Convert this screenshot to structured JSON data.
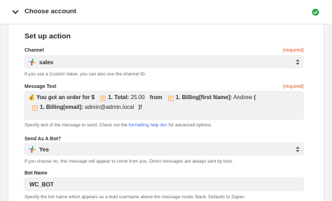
{
  "step": {
    "title": "Choose account"
  },
  "section": {
    "title": "Set up action"
  },
  "channel": {
    "label": "Channel",
    "required": "(required)",
    "value": "sales",
    "help": "If you use a Custom Value, you can also use the channel ID."
  },
  "message": {
    "label": "Message Text",
    "required": "(required)",
    "text_intro": "You got an order for $",
    "pill_total": "1. Total:",
    "total_value": "25.00",
    "from": "from",
    "pill_first_name": "1. Billing[first Name]:",
    "first_name_value": "Andrew",
    "paren_open": "(",
    "pill_email": "1. Billing[email]:",
    "email_value": "admin@admin.local",
    "close": ")!",
    "help_prefix": "Specify text of the message to send. Check out the",
    "help_link": "formatting help doc",
    "help_suffix": "for advanced options."
  },
  "bot": {
    "label": "Send As A Bot?",
    "value": "Yes",
    "help": "If you choose no, this message will appear to come from you. Direct messages are always sent by bots."
  },
  "bot_name": {
    "label": "Bot Name",
    "value": "WC_BOT",
    "help": "Specify the bot name which appears as a bold username above the message inside Slack. Defaults to Zapier."
  },
  "colors": {
    "accent": "#3d63dd",
    "required": "#e25a2a",
    "success": "#2fa84f",
    "field_bg": "#f1f1f3"
  },
  "icons": [
    "chevron-down-icon",
    "check-circle-icon",
    "slack-icon",
    "caret-updown-icon",
    "money-bag-icon",
    "zapier-step-icon"
  ]
}
